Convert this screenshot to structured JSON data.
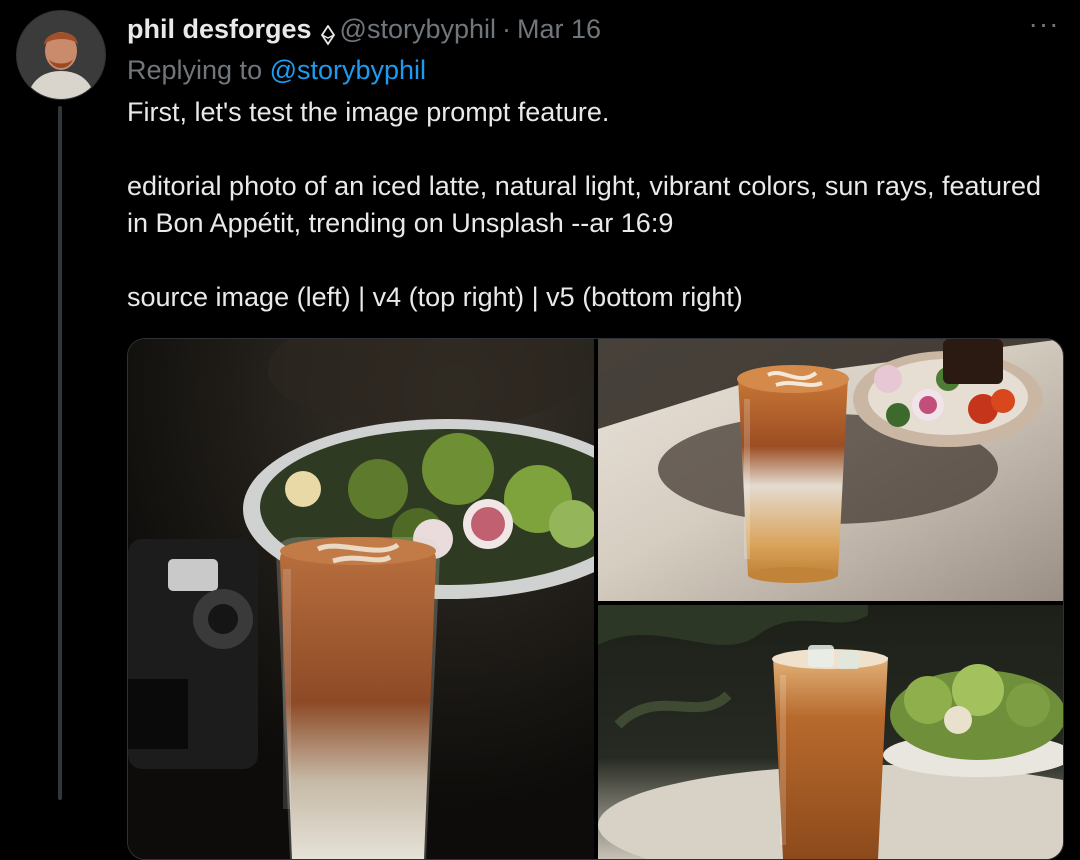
{
  "author": {
    "name": "phil desforges",
    "badge_icon": "diamond-icon",
    "handle": "@storybyphil",
    "separator": "·",
    "date": "Mar 16"
  },
  "reply": {
    "prefix": "Replying to ",
    "handle": "@storybyphil"
  },
  "tweet": {
    "line1": "First, let's test the image prompt feature.",
    "line2": "editorial photo of an iced latte, natural light, vibrant colors, sun rays, featured in Bon Appétit, trending on Unsplash --ar 16:9",
    "line3": "source image (left) | v4 (top right) | v5 (bottom right)"
  },
  "more_label": "···",
  "colors": {
    "background": "#000000",
    "text": "#e7e9ea",
    "muted": "#71767b",
    "link": "#1d9bf0",
    "border": "#2f3336"
  }
}
